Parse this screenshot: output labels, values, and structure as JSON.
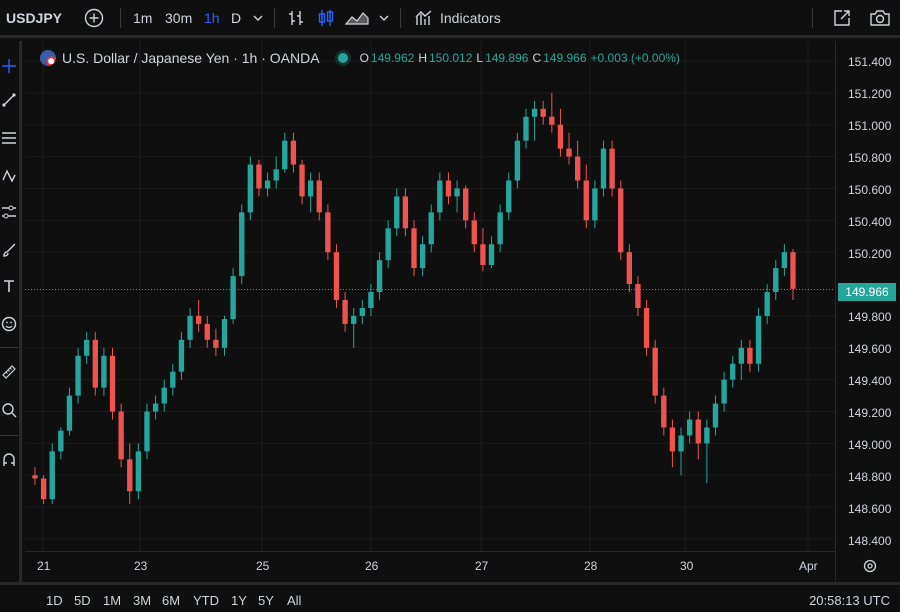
{
  "toolbar": {
    "symbol": "USDJPY",
    "intervals": [
      "1m",
      "30m",
      "1h",
      "D"
    ],
    "active_interval": "1h",
    "indicators_label": "Indicators"
  },
  "legend": {
    "title": "U.S. Dollar / Japanese Yen · 1h · OANDA",
    "open_label": "O",
    "open": "149.962",
    "high_label": "H",
    "high": "150.012",
    "low_label": "L",
    "low": "149.896",
    "close_label": "C",
    "close": "149.966",
    "change": "+0.003 (+0.00%)"
  },
  "price_axis": {
    "ticks": [
      "151.400",
      "151.200",
      "151.000",
      "150.800",
      "150.600",
      "150.400",
      "150.200",
      "149.800",
      "149.600",
      "149.400",
      "149.200",
      "149.000",
      "148.800",
      "148.600",
      "148.400"
    ],
    "current_price": "149.966"
  },
  "time_axis": {
    "ticks": [
      "21",
      "23",
      "25",
      "26",
      "27",
      "28",
      "30",
      "Apr"
    ]
  },
  "bottom": {
    "ranges": [
      "1D",
      "5D",
      "1M",
      "3M",
      "6M",
      "YTD",
      "1Y",
      "5Y",
      "All"
    ],
    "clock": "20:58:13 UTC"
  },
  "colors": {
    "up": "#26a69a",
    "down": "#ef5350",
    "accent": "#2962ff",
    "background": "#0f0f0f"
  },
  "chart_data": {
    "type": "candlestick",
    "symbol": "USDJPY",
    "interval": "1h",
    "ylim": [
      148.4,
      151.4
    ],
    "x_tick_labels": [
      "21",
      "23",
      "25",
      "26",
      "27",
      "28",
      "30",
      "Apr"
    ],
    "last_close": 149.966,
    "candles": [
      [
        148.8,
        148.85,
        148.74,
        148.78
      ],
      [
        148.78,
        148.8,
        148.62,
        148.65
      ],
      [
        148.65,
        149.0,
        148.62,
        148.95
      ],
      [
        148.95,
        149.1,
        148.9,
        149.08
      ],
      [
        149.08,
        149.35,
        149.05,
        149.3
      ],
      [
        149.3,
        149.6,
        149.25,
        149.55
      ],
      [
        149.55,
        149.7,
        149.5,
        149.65
      ],
      [
        149.65,
        149.7,
        149.3,
        149.35
      ],
      [
        149.35,
        149.6,
        149.3,
        149.55
      ],
      [
        149.55,
        149.6,
        149.15,
        149.2
      ],
      [
        149.2,
        149.25,
        148.85,
        148.9
      ],
      [
        148.9,
        149.0,
        148.62,
        148.7
      ],
      [
        148.7,
        149.0,
        148.65,
        148.95
      ],
      [
        148.95,
        149.25,
        148.9,
        149.2
      ],
      [
        149.2,
        149.3,
        149.15,
        149.25
      ],
      [
        149.25,
        149.4,
        149.2,
        149.35
      ],
      [
        149.35,
        149.5,
        149.3,
        149.45
      ],
      [
        149.45,
        149.7,
        149.4,
        149.65
      ],
      [
        149.65,
        149.85,
        149.6,
        149.8
      ],
      [
        149.8,
        149.9,
        149.7,
        149.75
      ],
      [
        149.75,
        149.8,
        149.6,
        149.65
      ],
      [
        149.65,
        149.72,
        149.55,
        149.6
      ],
      [
        149.6,
        149.8,
        149.55,
        149.78
      ],
      [
        149.78,
        150.1,
        149.75,
        150.05
      ],
      [
        150.05,
        150.5,
        150.0,
        150.45
      ],
      [
        150.45,
        150.8,
        150.4,
        150.75
      ],
      [
        150.75,
        150.78,
        150.55,
        150.6
      ],
      [
        150.6,
        150.7,
        150.55,
        150.65
      ],
      [
        150.65,
        150.8,
        150.6,
        150.72
      ],
      [
        150.72,
        150.95,
        150.7,
        150.9
      ],
      [
        150.9,
        150.95,
        150.7,
        150.75
      ],
      [
        150.75,
        150.78,
        150.5,
        150.55
      ],
      [
        150.55,
        150.7,
        150.45,
        150.65
      ],
      [
        150.65,
        150.7,
        150.4,
        150.45
      ],
      [
        150.45,
        150.5,
        150.15,
        150.2
      ],
      [
        150.2,
        150.25,
        149.85,
        149.9
      ],
      [
        149.9,
        149.95,
        149.7,
        149.75
      ],
      [
        149.75,
        149.85,
        149.6,
        149.8
      ],
      [
        149.8,
        149.9,
        149.75,
        149.85
      ],
      [
        149.85,
        150.0,
        149.8,
        149.95
      ],
      [
        149.95,
        150.2,
        149.9,
        150.15
      ],
      [
        150.15,
        150.4,
        150.1,
        150.35
      ],
      [
        150.35,
        150.6,
        150.3,
        150.55
      ],
      [
        150.55,
        150.6,
        150.3,
        150.35
      ],
      [
        150.35,
        150.4,
        150.05,
        150.1
      ],
      [
        150.1,
        150.3,
        150.05,
        150.25
      ],
      [
        150.25,
        150.5,
        150.2,
        150.45
      ],
      [
        150.45,
        150.7,
        150.4,
        150.65
      ],
      [
        150.65,
        150.7,
        150.5,
        150.55
      ],
      [
        150.55,
        150.65,
        150.45,
        150.6
      ],
      [
        150.6,
        150.62,
        150.35,
        150.4
      ],
      [
        150.4,
        150.45,
        150.2,
        150.25
      ],
      [
        150.25,
        150.35,
        150.08,
        150.12
      ],
      [
        150.12,
        150.3,
        150.1,
        150.25
      ],
      [
        150.25,
        150.5,
        150.2,
        150.45
      ],
      [
        150.45,
        150.7,
        150.4,
        150.65
      ],
      [
        150.65,
        150.95,
        150.6,
        150.9
      ],
      [
        150.9,
        151.1,
        150.85,
        151.05
      ],
      [
        151.05,
        151.15,
        150.9,
        151.1
      ],
      [
        151.1,
        151.15,
        151.0,
        151.05
      ],
      [
        151.05,
        151.2,
        150.95,
        151.0
      ],
      [
        151.0,
        151.1,
        150.8,
        150.85
      ],
      [
        150.85,
        150.95,
        150.75,
        150.8
      ],
      [
        150.8,
        150.9,
        150.6,
        150.65
      ],
      [
        150.65,
        150.75,
        150.35,
        150.4
      ],
      [
        150.4,
        150.65,
        150.35,
        150.6
      ],
      [
        150.6,
        150.9,
        150.55,
        150.85
      ],
      [
        150.85,
        150.9,
        150.55,
        150.6
      ],
      [
        150.6,
        150.65,
        150.15,
        150.2
      ],
      [
        150.2,
        150.25,
        149.95,
        150.0
      ],
      [
        150.0,
        150.05,
        149.8,
        149.85
      ],
      [
        149.85,
        149.9,
        149.55,
        149.6
      ],
      [
        149.6,
        149.65,
        149.25,
        149.3
      ],
      [
        149.3,
        149.35,
        149.05,
        149.1
      ],
      [
        149.1,
        149.15,
        148.85,
        148.95
      ],
      [
        148.95,
        149.1,
        148.8,
        149.05
      ],
      [
        149.05,
        149.2,
        149.0,
        149.15
      ],
      [
        149.15,
        149.2,
        148.9,
        149.0
      ],
      [
        149.0,
        149.15,
        148.75,
        149.1
      ],
      [
        149.1,
        149.3,
        149.05,
        149.25
      ],
      [
        149.25,
        149.45,
        149.2,
        149.4
      ],
      [
        149.4,
        149.55,
        149.35,
        149.5
      ],
      [
        149.5,
        149.65,
        149.4,
        149.6
      ],
      [
        149.6,
        149.65,
        149.45,
        149.5
      ],
      [
        149.5,
        149.85,
        149.45,
        149.8
      ],
      [
        149.8,
        150.0,
        149.75,
        149.95
      ],
      [
        149.95,
        150.15,
        149.9,
        150.1
      ],
      [
        150.1,
        150.25,
        150.05,
        150.2
      ],
      [
        150.2,
        150.22,
        149.9,
        149.97
      ]
    ]
  }
}
